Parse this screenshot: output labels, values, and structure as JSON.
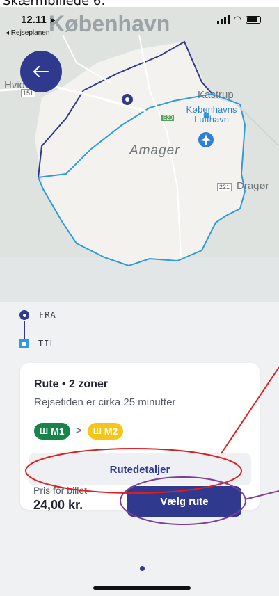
{
  "caption": "Skærmbillede 6:",
  "status_bar": {
    "time": "12.11",
    "back_app": "◂ Rejseplanen"
  },
  "map": {
    "labels": {
      "city": "København",
      "hvidovre": "Hvidovre",
      "kastrup": "Kastrup",
      "airport": "Københavns Lufthavn",
      "amager": "Amager",
      "dragor": "Dragør",
      "road_151": "151",
      "road_e20": "E20",
      "road_221": "221"
    },
    "colors": {
      "zone_outline_dark": "#2f3a8f",
      "zone_outline_light": "#2f9bd8",
      "zone_fill": "#f3f2ef"
    }
  },
  "route": {
    "from_label": "FRA",
    "to_label": "TIL"
  },
  "card": {
    "title": "Rute • 2 zoner",
    "subtitle": "Rejsetiden er cirka 25 minutter",
    "lines": [
      {
        "name": "M1",
        "color": "#17844a",
        "icon": "metro-icon"
      },
      {
        "name": "M2",
        "color": "#f5c518",
        "icon": "metro-icon"
      }
    ],
    "details_button": "Rutedetaljer",
    "price_label": "Pris for billet",
    "price_value": "24,00 kr.",
    "choose_button": "Vælg rute"
  },
  "colors": {
    "primary": "#2f3a8f",
    "annotation_red": "#e11d1d",
    "annotation_purple": "#7d3c98"
  }
}
